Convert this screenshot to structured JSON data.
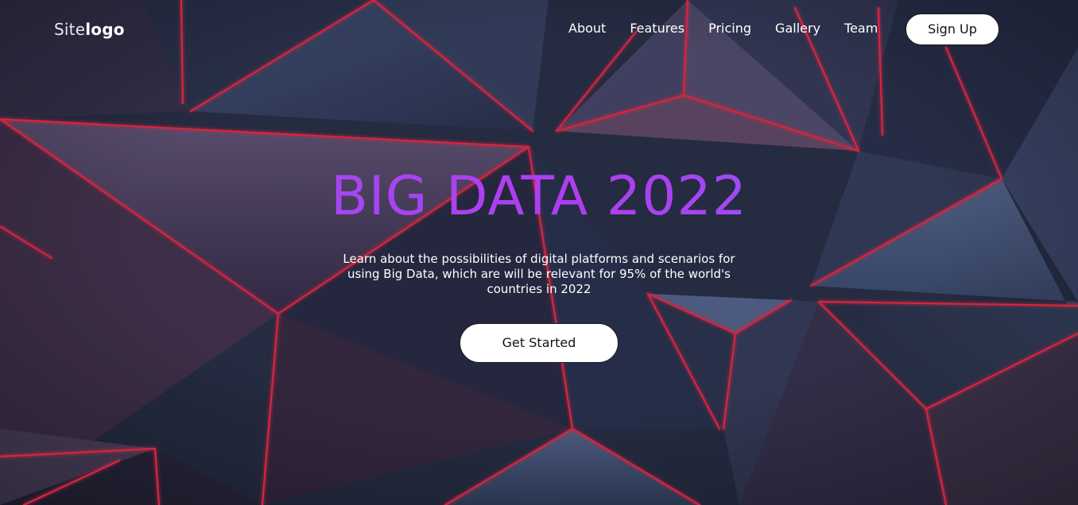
{
  "brand": {
    "logo_light": "Site",
    "logo_bold": "logo"
  },
  "nav": {
    "items": [
      {
        "label": "About"
      },
      {
        "label": "Features"
      },
      {
        "label": "Pricing"
      },
      {
        "label": "Gallery"
      },
      {
        "label": "Team"
      }
    ],
    "signup_label": "Sign Up"
  },
  "hero": {
    "title": "BIG DATA 2022",
    "subtitle": "Learn about the possibilities of digital platforms and scenarios for using Big Data, which are will be relevant for 95% of the world's countries in 2022",
    "cta_label": "Get Started",
    "background": "dark geometric triangles with red neon edges"
  },
  "colors": {
    "title_gradient_start": "#6f6ef5",
    "title_gradient_mid": "#b03cf0",
    "neon_edge": "#ff2a4a",
    "button_bg": "#ffffff",
    "text": "#ffffff"
  }
}
